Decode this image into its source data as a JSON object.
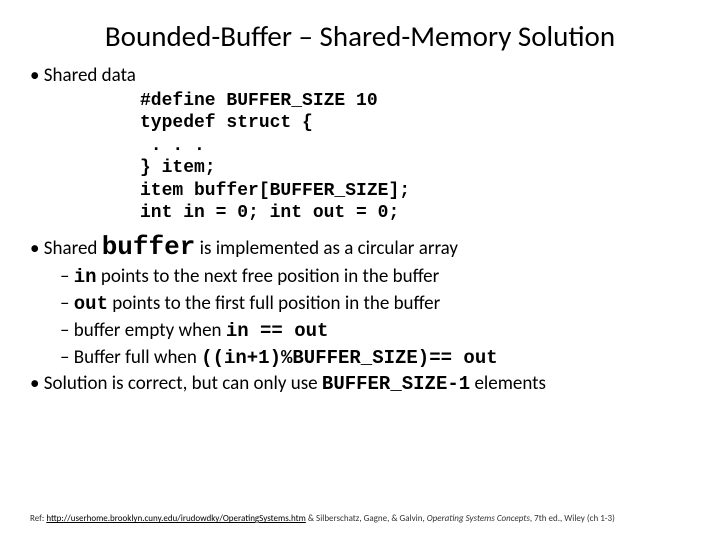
{
  "title": "Bounded-Buffer – Shared-Memory Solution",
  "b1_shared_data": "Shared data",
  "code": "#define BUFFER_SIZE 10\ntypedef struct {\n . . .\n} item;\nitem buffer[BUFFER_SIZE];\nint in = 0; int out = 0;",
  "shared_prefix": "Shared",
  "buffer_word": "buffer",
  "shared_suffix": " is implemented as a circular array",
  "in_pre": "",
  "in_code": "in",
  "in_post": " points to the next free position in the buffer",
  "out_code": "out",
  "out_post": " points to the first full position in the buffer",
  "empty_pre": "buffer empty when ",
  "empty_code": "in == out",
  "full_pre": "Buffer full when ",
  "full_code": "((in+1)%BUFFER_SIZE)== out",
  "sol_pre": "Solution is correct, but can only use ",
  "sol_code": "BUFFER_SIZE-1",
  "sol_post": " elements",
  "footer_ref": "Ref: ",
  "footer_link": "http://userhome.brooklyn.cuny.edu/irudowdky/OperatingSystems.htm",
  "footer_mid": " & Silberschatz, Gagne, & Galvin, ",
  "footer_book": "Operating Systems Concepts",
  "footer_tail": ", 7th ed., Wiley (ch 1-3)"
}
